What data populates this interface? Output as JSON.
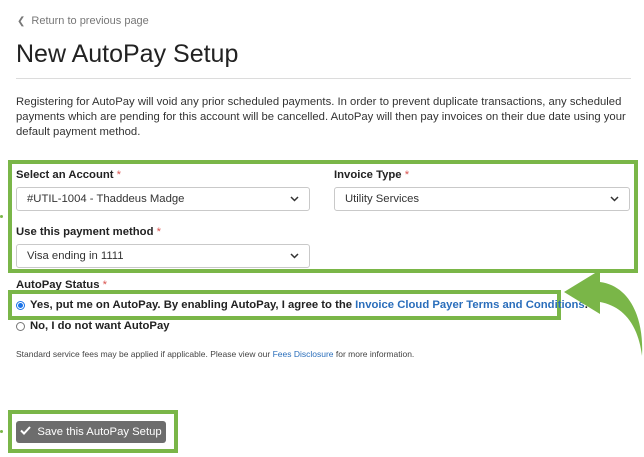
{
  "nav": {
    "back_label": "Return to previous page"
  },
  "page": {
    "title": "New AutoPay Setup"
  },
  "intro_text": "Registering for AutoPay will void any prior scheduled payments. In order to prevent duplicate transactions, any scheduled payments which are pending for this account will be cancelled. AutoPay will then pay invoices on their due date using your default payment method.",
  "form": {
    "account": {
      "label": "Select an Account",
      "required_mark": "*",
      "value": "#UTIL-1004 - Thaddeus Madge"
    },
    "invoice_type": {
      "label": "Invoice Type",
      "required_mark": "*",
      "value": "Utility Services"
    },
    "payment_method": {
      "label": "Use this payment method",
      "required_mark": "*",
      "value": "Visa ending in 1111"
    }
  },
  "autopay_status": {
    "label": "AutoPay Status",
    "required_mark": "*",
    "yes_text": "Yes, put me on AutoPay. By enabling AutoPay, I agree to the ",
    "yes_link": "Invoice Cloud Payer Terms and Conditions",
    "yes_end": ".",
    "no_text": "No, I do not want AutoPay",
    "selected": "yes"
  },
  "fees_notice": {
    "before": "Standard service fees may be applied if applicable. Please view our ",
    "link": "Fees Disclosure",
    "after": " for more information."
  },
  "save_button": {
    "label": "Save this AutoPay Setup"
  },
  "colors": {
    "highlight": "#7ab648",
    "link": "#2a6ebb",
    "required": "#d9534f",
    "button": "#6d6d6d"
  }
}
